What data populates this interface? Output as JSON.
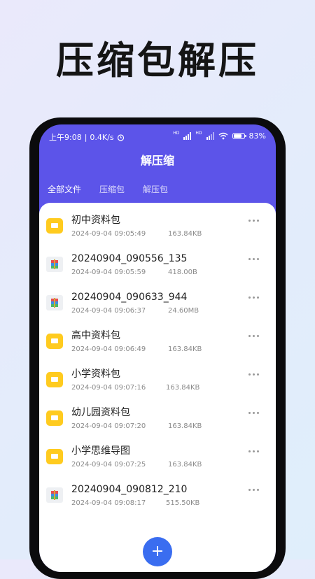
{
  "hero": {
    "title": "压缩包解压"
  },
  "status_bar": {
    "time": "上午9:08",
    "speed": "0.4K/s",
    "battery": "83",
    "battery_level": 0.83,
    "icons": [
      "alarm-icon",
      "signal-icon",
      "wifi-icon",
      "battery-icon"
    ]
  },
  "app": {
    "title": "解压缩"
  },
  "tabs": [
    {
      "label": "全部文件",
      "active": true
    },
    {
      "label": "压缩包",
      "active": false
    },
    {
      "label": "解压包",
      "active": false
    }
  ],
  "files": [
    {
      "name": "初中资料包",
      "date": "2024-09-04 09:05:49",
      "size": "163.84KB",
      "type": "folder"
    },
    {
      "name": "20240904_090556_135",
      "date": "2024-09-04 09:05:59",
      "size": "418.00B",
      "type": "archive"
    },
    {
      "name": "20240904_090633_944",
      "date": "2024-09-04 09:06:37",
      "size": "24.60MB",
      "type": "archive"
    },
    {
      "name": "高中资料包",
      "date": "2024-09-04 09:06:49",
      "size": "163.84KB",
      "type": "folder"
    },
    {
      "name": "小学资料包",
      "date": "2024-09-04 09:07:16",
      "size": "163.84KB",
      "type": "folder"
    },
    {
      "name": "幼儿园资料包",
      "date": "2024-09-04 09:07:20",
      "size": "163.84KB",
      "type": "folder"
    },
    {
      "name": "小学思维导图",
      "date": "2024-09-04 09:07:25",
      "size": "163.84KB",
      "type": "folder"
    },
    {
      "name": "20240904_090812_210",
      "date": "2024-09-04 09:08:17",
      "size": "515.50KB",
      "type": "archive"
    }
  ],
  "fab": {
    "label": "+"
  },
  "colors": {
    "primary": "#5c54e9",
    "folder": "#ffcb1f",
    "fab": "#3a6df0"
  }
}
